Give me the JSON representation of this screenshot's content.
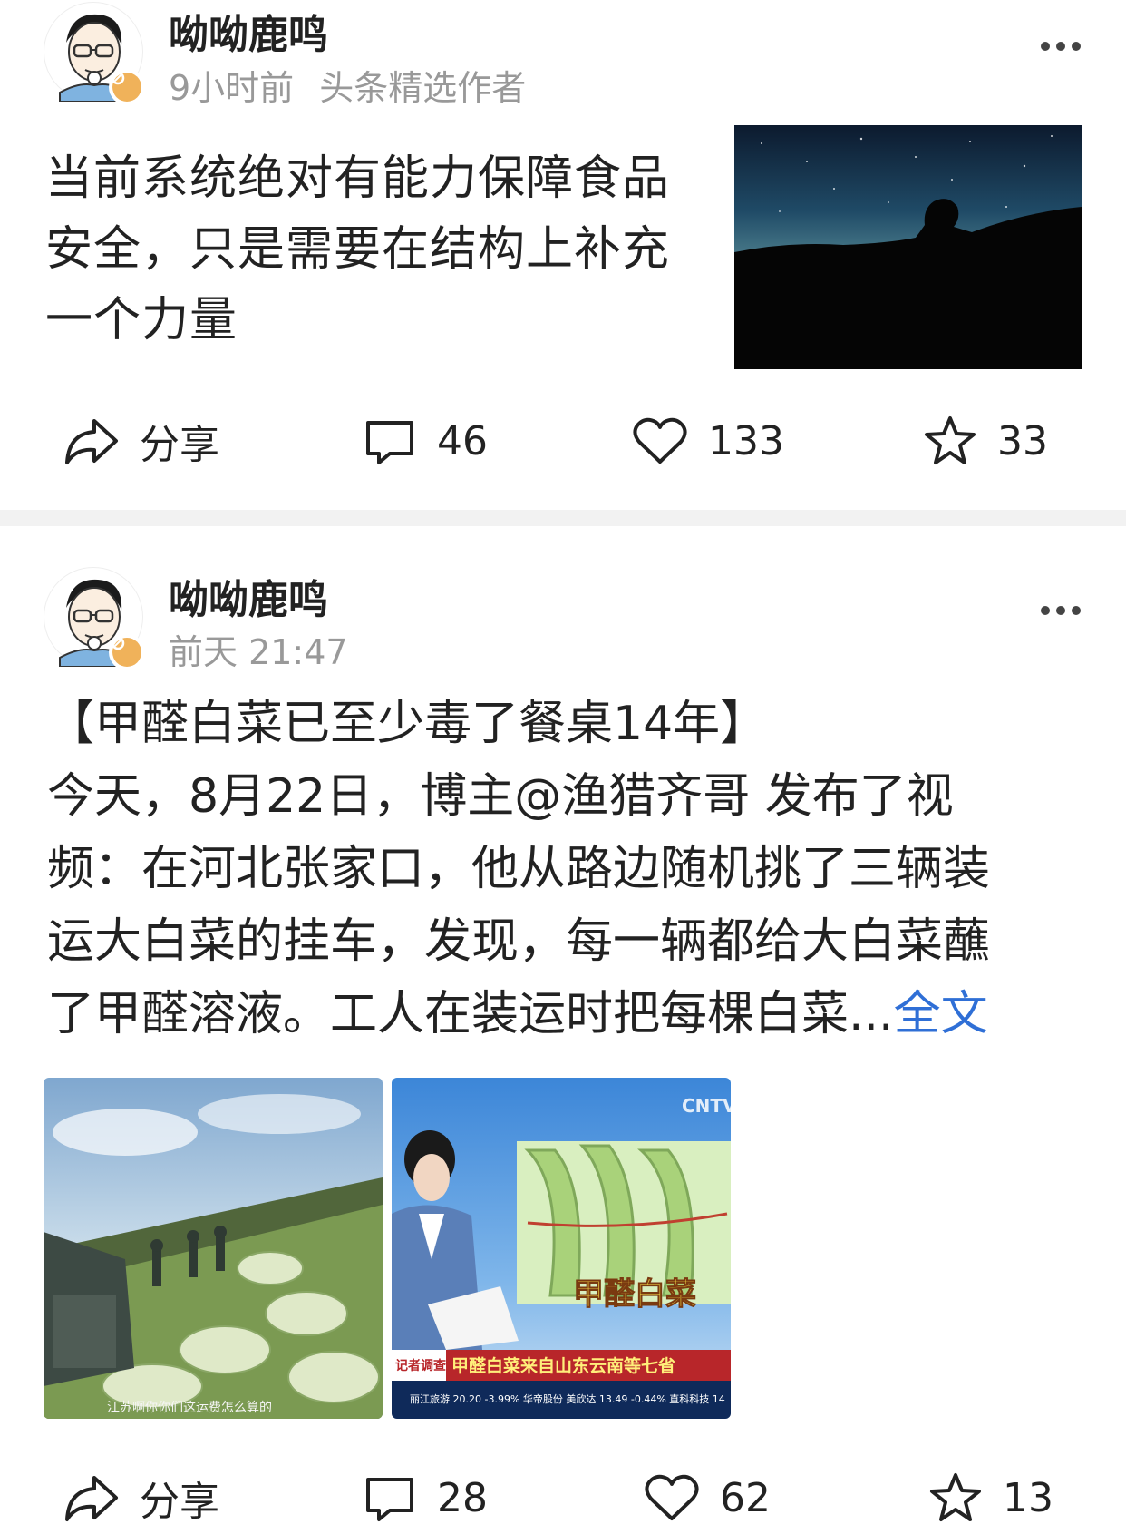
{
  "posts": [
    {
      "author": "呦呦鹿鸣",
      "time": "9小时前",
      "tag": "头条精选作者",
      "text": "当前系统绝对有能力保障食品安全，只是需要在结构上补充一个力量",
      "actions": {
        "share": "分享",
        "comments": "46",
        "likes": "133",
        "favorites": "33"
      }
    },
    {
      "author": "呦呦鹿鸣",
      "time": "前天 21:47",
      "lines": [
        "【甲醛白菜已至少毒了餐桌14年】",
        "今天，8月22日，博主@渔猎齐哥 发布了视",
        "频：在河北张家口，他从路边随机挑了三辆装",
        "运大白菜的挂车，发现，每一辆都给大白菜蘸",
        "了甲醛溶液。工人在装运时把每棵白菜..."
      ],
      "full_text_link": "全文",
      "images": [
        {
          "caption": "江苏啊你你们这运费怎么算的"
        },
        {
          "channel": "CNTV",
          "overlay_title": "甲醛白菜",
          "banner": "甲醛白菜来自山东云南等七省",
          "tag": "记者调查",
          "ticker": "丽江旅游 20.20 -3.99%  华帝股份  美欣达 13.49 -0.44%  直科科技 14"
        }
      ],
      "actions": {
        "share": "分享",
        "comments": "28",
        "likes": "62",
        "favorites": "13"
      }
    }
  ],
  "colors": {
    "link": "#2f6fd6",
    "meta": "#999999",
    "divider": "#f2f2f2",
    "badge": "#f0b25a"
  }
}
